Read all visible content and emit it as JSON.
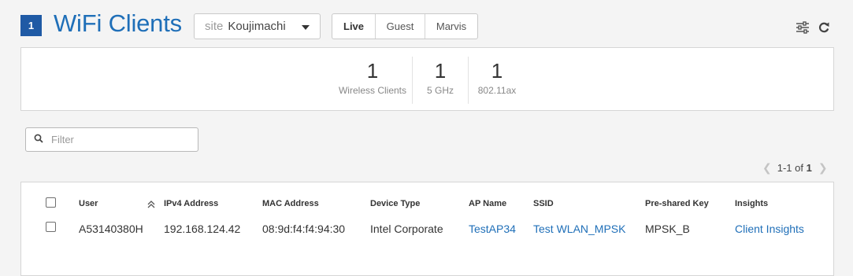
{
  "header": {
    "client_count": "1",
    "title": "WiFi Clients",
    "site_label": "site",
    "site_value": "Koujimachi",
    "view_options": [
      "Live",
      "Guest",
      "Marvis"
    ]
  },
  "stats": [
    {
      "value": "1",
      "caption": "Wireless Clients"
    },
    {
      "value": "1",
      "caption": "5 GHz"
    },
    {
      "value": "1",
      "caption": "802.11ax"
    }
  ],
  "filter": {
    "placeholder": "Filter"
  },
  "pagination": {
    "range": "1-1",
    "of": "of",
    "total": "1"
  },
  "table": {
    "columns": [
      "User",
      "IPv4 Address",
      "MAC Address",
      "Device Type",
      "AP Name",
      "SSID",
      "Pre-shared Key",
      "Insights"
    ],
    "rows": [
      {
        "user": "A53140380H",
        "ipv4": "192.168.124.42",
        "mac": "08:9d:f4:f4:94:30",
        "device_type": "Intel Corporate",
        "ap_name": "TestAP34",
        "ssid": "Test WLAN_MPSK",
        "psk": "MPSK_B",
        "insights": "Client Insights"
      }
    ]
  },
  "colors": {
    "accent": "#1f6fb8",
    "badge": "#1f5aa5",
    "background": "#f4f4f4"
  }
}
